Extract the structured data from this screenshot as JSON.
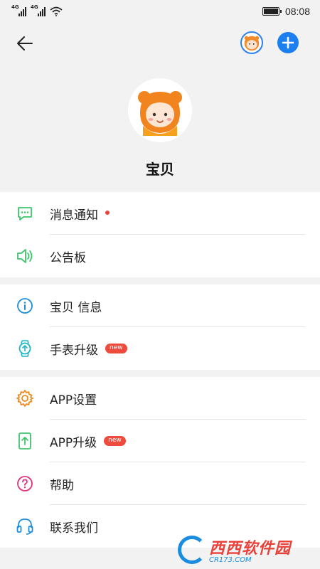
{
  "status_bar": {
    "network_1": "4G",
    "network_2": "4G",
    "time": "08:08"
  },
  "header": {
    "back_icon": "arrow-left-icon",
    "add_icon": "plus-icon",
    "add_color": "#1b7ff0"
  },
  "profile": {
    "name": "宝贝"
  },
  "section1": {
    "items": [
      {
        "label": "消息通知",
        "icon": "message-icon",
        "color": "#3ec56c"
      },
      {
        "label": "公告板",
        "icon": "speaker-icon",
        "color": "#3ec56c"
      }
    ]
  },
  "section2": {
    "items": [
      {
        "label": "宝贝 信息",
        "icon": "info-icon",
        "color": "#1a8de0"
      },
      {
        "label": "手表升级",
        "icon": "watch-icon",
        "color": "#1bb7c4",
        "badge": "new"
      }
    ]
  },
  "section3": {
    "items": [
      {
        "label": "APP设置",
        "icon": "gear-icon",
        "color": "#ef8a1e"
      },
      {
        "label": "APP升级",
        "icon": "phone-upgrade-icon",
        "color": "#3ec56c",
        "badge": "new"
      },
      {
        "label": "帮助",
        "icon": "help-icon",
        "color": "#e0327f"
      },
      {
        "label": "联系我们",
        "icon": "headset-icon",
        "color": "#1a8de0"
      }
    ]
  },
  "watermark": {
    "main": "西西软件园",
    "sub": "CR173.COM"
  }
}
